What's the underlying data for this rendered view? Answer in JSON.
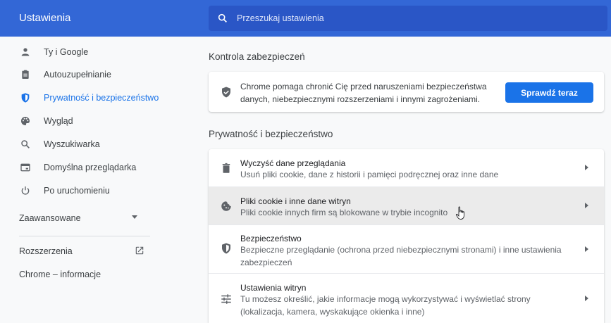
{
  "header": {
    "title": "Ustawienia",
    "search_placeholder": "Przeszukaj ustawienia"
  },
  "sidebar": {
    "items": [
      {
        "label": "Ty i Google",
        "icon": "person-icon",
        "active": false
      },
      {
        "label": "Autouzupełnianie",
        "icon": "clipboard-icon",
        "active": false
      },
      {
        "label": "Prywatność i bezpieczeństwo",
        "icon": "shield-icon",
        "active": true
      },
      {
        "label": "Wygląd",
        "icon": "palette-icon",
        "active": false
      },
      {
        "label": "Wyszukiwarka",
        "icon": "search-icon",
        "active": false
      },
      {
        "label": "Domyślna przeglądarka",
        "icon": "browser-window-icon",
        "active": false
      },
      {
        "label": "Po uruchomieniu",
        "icon": "power-icon",
        "active": false
      }
    ],
    "advanced_label": "Zaawansowane",
    "extensions_label": "Rozszerzenia",
    "about_label": "Chrome – informacje"
  },
  "safety_check": {
    "section_title": "Kontrola zabezpieczeń",
    "description": "Chrome pomaga chronić Cię przed naruszeniami bezpieczeństwa danych, niebezpiecznymi rozszerzeniami i innymi zagrożeniami.",
    "button_label": "Sprawdź teraz"
  },
  "privacy": {
    "section_title": "Prywatność i bezpieczeństwo",
    "rows": [
      {
        "title": "Wyczyść dane przeglądania",
        "subtitle": "Usuń pliki cookie, dane z historii i pamięci podręcznej oraz inne dane",
        "icon": "trash-icon"
      },
      {
        "title": "Pliki cookie i inne dane witryn",
        "subtitle": "Pliki cookie innych firm są blokowane w trybie incognito",
        "icon": "cookie-icon"
      },
      {
        "title": "Bezpieczeństwo",
        "subtitle": "Bezpieczne przeglądanie (ochrona przed niebezpiecznymi stronami) i inne ustawienia zabezpieczeń",
        "icon": "security-shield-icon"
      },
      {
        "title": "Ustawienia witryn",
        "subtitle": "Tu możesz określić, jakie informacje mogą wykorzystywać i wyświetlać strony (lokalizacja, kamera, wyskakujące okienka i inne)",
        "icon": "sliders-icon"
      }
    ]
  },
  "colors": {
    "header_bg": "#3367d6",
    "accent": "#1a73e8"
  }
}
